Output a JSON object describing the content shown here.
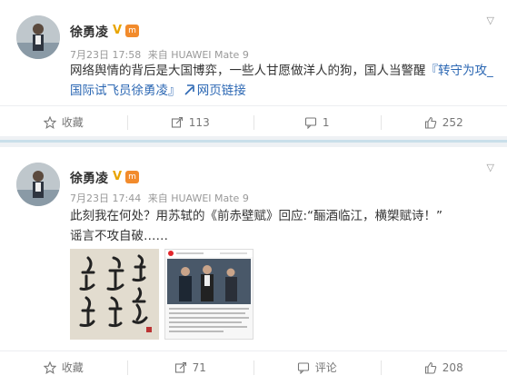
{
  "posts": [
    {
      "username": "徐勇凌",
      "meta": {
        "time": "7月23日 17:58",
        "source": "来自 HUAWEI Mate 9"
      },
      "text_main": "网络舆情的背后是大国博弈，一些人甘愿做洋人的狗，国人当警醒",
      "text_link": "『转守为攻_国际试飞员徐勇凌』",
      "weblink_label": "网页链接",
      "actions": {
        "favorite": "收藏",
        "repost": "113",
        "comment": "1",
        "like": "252"
      }
    },
    {
      "username": "徐勇凌",
      "meta": {
        "time": "7月23日 17:44",
        "source": "来自 HUAWEI Mate 9"
      },
      "text_line1": "此刻我在何处？用苏轼的《前赤壁赋》回应:“酾酒临江，横槊赋诗！”",
      "text_line2": "谣言不攻自破……",
      "actions": {
        "favorite": "收藏",
        "repost": "71",
        "comment": "评论",
        "like": "208"
      }
    }
  ],
  "icons": {
    "verified": "V",
    "level": "m"
  },
  "colors": {
    "link": "#2b67b3",
    "verified": "#e8a400"
  }
}
